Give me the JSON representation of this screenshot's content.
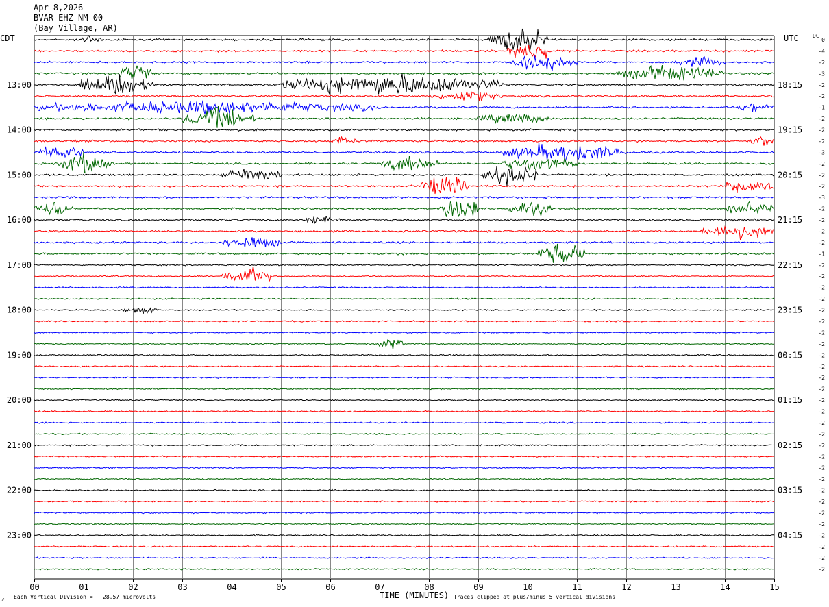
{
  "header": {
    "date": "Apr 8,2026",
    "station": "BVAR EHZ NM 00",
    "location": "(Bay Village, AR)"
  },
  "left_zone": "CDT",
  "right_zone": "UTC",
  "dc_label": "DC",
  "footer": {
    "corner_mark": "↗",
    "scale_text": "Each Vertical Division =   28.57 microvolts",
    "xlabel": "TIME (MINUTES)",
    "clip_text": "Traces clipped at plus/minus 5 vertical divisions"
  },
  "colors": {
    "black": "#000000",
    "red": "#ff0000",
    "blue": "#0000ff",
    "green": "#006600",
    "grid": "#888888"
  },
  "chart_data": {
    "type": "line",
    "title": "BVAR EHZ NM 00",
    "xlabel": "TIME (MINUTES)",
    "x_ticks": [
      "00",
      "01",
      "02",
      "03",
      "04",
      "05",
      "06",
      "07",
      "08",
      "09",
      "10",
      "11",
      "12",
      "13",
      "14",
      "15"
    ],
    "xlim": [
      0,
      15
    ],
    "grid": "vertical",
    "color_cycle": [
      "black",
      "red",
      "blue",
      "green"
    ],
    "left_hour_labels": [
      "13:00",
      "14:00",
      "15:00",
      "16:00",
      "17:00",
      "18:00",
      "19:00",
      "20:00",
      "21:00",
      "22:00",
      "23:00"
    ],
    "right_hour_labels": [
      "18:15",
      "19:15",
      "20:15",
      "21:15",
      "22:15",
      "23:15",
      "00:15",
      "01:15",
      "02:15",
      "03:15",
      "04:15"
    ],
    "dc_offsets": [
      "0",
      "-4",
      "-2",
      "-3",
      "-2",
      "-2",
      "-1",
      "-2",
      "-2",
      "-2",
      "-3",
      "-2",
      "-2",
      "-2",
      "-3",
      "-2",
      "-2",
      "-2",
      "-2",
      "-1",
      "-2",
      "-2",
      "-2",
      "-2",
      "-2",
      "-2",
      "-2",
      "-2",
      "-2",
      "-2",
      "-2",
      "-2",
      "-2",
      "-2",
      "-2",
      "-2",
      "-2",
      "-2",
      "-2",
      "-2",
      "-2",
      "-2",
      "-2",
      "-2",
      "-2",
      "-2",
      "-2",
      "-2"
    ],
    "trace_count": 48,
    "minutes_per_trace": 15,
    "events": [
      {
        "trace": 0,
        "start": 9.2,
        "end": 10.4,
        "amp": 5
      },
      {
        "trace": 0,
        "start": 0.9,
        "end": 1.4,
        "amp": 2
      },
      {
        "trace": 1,
        "start": 9.6,
        "end": 10.5,
        "amp": 4
      },
      {
        "trace": 2,
        "start": 9.7,
        "end": 11.0,
        "amp": 3
      },
      {
        "trace": 2,
        "start": 13.0,
        "end": 14.0,
        "amp": 2
      },
      {
        "trace": 3,
        "start": 11.8,
        "end": 14.0,
        "amp": 3
      },
      {
        "trace": 3,
        "start": 1.7,
        "end": 2.4,
        "amp": 4
      },
      {
        "trace": 4,
        "start": 0.9,
        "end": 2.4,
        "amp": 4
      },
      {
        "trace": 4,
        "start": 5.0,
        "end": 9.5,
        "amp": 4
      },
      {
        "trace": 5,
        "start": 8.0,
        "end": 9.5,
        "amp": 2
      },
      {
        "trace": 6,
        "start": 0.0,
        "end": 7.0,
        "amp": 2.5
      },
      {
        "trace": 6,
        "start": 14.2,
        "end": 15.0,
        "amp": 2
      },
      {
        "trace": 7,
        "start": 3.0,
        "end": 4.5,
        "amp": 4
      },
      {
        "trace": 7,
        "start": 9.0,
        "end": 10.5,
        "amp": 2
      },
      {
        "trace": 9,
        "start": 6.0,
        "end": 6.5,
        "amp": 2
      },
      {
        "trace": 9,
        "start": 14.5,
        "end": 15.0,
        "amp": 2
      },
      {
        "trace": 10,
        "start": 0.0,
        "end": 1.0,
        "amp": 2.5
      },
      {
        "trace": 10,
        "start": 9.5,
        "end": 12.0,
        "amp": 3.5
      },
      {
        "trace": 11,
        "start": 0.5,
        "end": 1.6,
        "amp": 4
      },
      {
        "trace": 11,
        "start": 7.0,
        "end": 8.2,
        "amp": 3
      },
      {
        "trace": 11,
        "start": 9.5,
        "end": 11.0,
        "amp": 3
      },
      {
        "trace": 12,
        "start": 3.8,
        "end": 5.0,
        "amp": 3
      },
      {
        "trace": 12,
        "start": 9.1,
        "end": 10.2,
        "amp": 4
      },
      {
        "trace": 13,
        "start": 7.8,
        "end": 8.8,
        "amp": 4
      },
      {
        "trace": 13,
        "start": 14.0,
        "end": 15.0,
        "amp": 3
      },
      {
        "trace": 15,
        "start": 0.0,
        "end": 0.8,
        "amp": 3
      },
      {
        "trace": 15,
        "start": 8.2,
        "end": 9.0,
        "amp": 5
      },
      {
        "trace": 15,
        "start": 9.6,
        "end": 10.5,
        "amp": 3
      },
      {
        "trace": 15,
        "start": 14.0,
        "end": 15.0,
        "amp": 3
      },
      {
        "trace": 16,
        "start": 5.5,
        "end": 6.2,
        "amp": 2
      },
      {
        "trace": 17,
        "start": 13.5,
        "end": 15.0,
        "amp": 3
      },
      {
        "trace": 18,
        "start": 3.8,
        "end": 5.0,
        "amp": 2.5
      },
      {
        "trace": 19,
        "start": 10.2,
        "end": 11.2,
        "amp": 4
      },
      {
        "trace": 21,
        "start": 3.8,
        "end": 4.8,
        "amp": 3.5
      },
      {
        "trace": 24,
        "start": 1.8,
        "end": 2.5,
        "amp": 1.5
      },
      {
        "trace": 27,
        "start": 7.0,
        "end": 7.5,
        "amp": 2
      }
    ]
  }
}
